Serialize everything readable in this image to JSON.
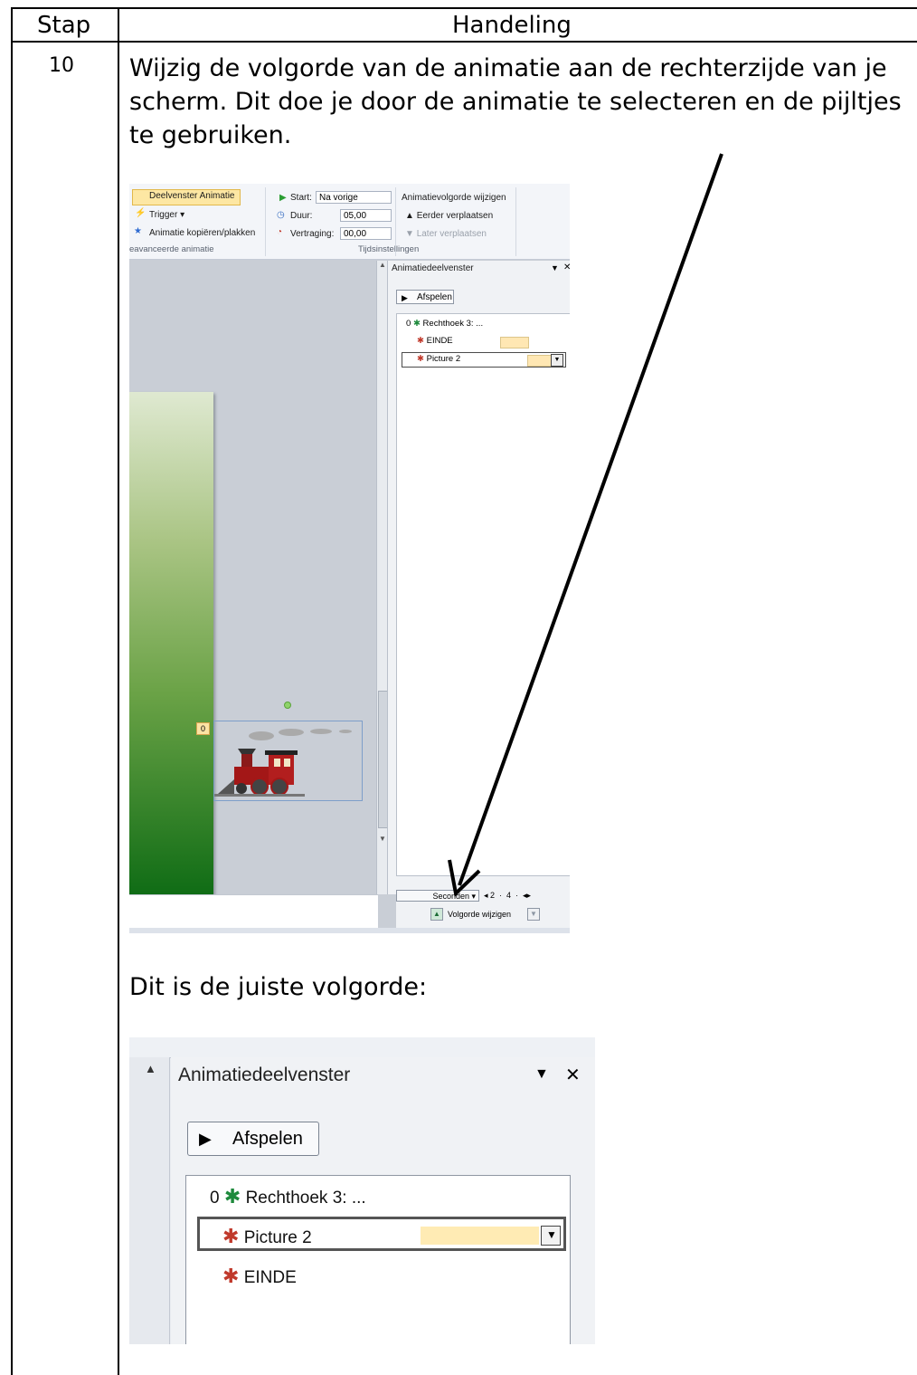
{
  "table": {
    "header_step": "Stap",
    "header_action": "Handeling",
    "step_number": "10",
    "instruction": "Wijzig de volgorde van de animatie aan de rechterzijde van je scherm. Dit doe je door de animatie te selecteren en de pijltjes te gebruiken.",
    "correct_order_label": "Dit is de juiste volgorde:"
  },
  "screenshot1": {
    "ribbon": {
      "pane_button": "Deelvenster Animatie",
      "trigger": "Trigger ▾",
      "copy_paste": "Animatie kopiëren/plakken",
      "group_advanced": "eavanceerde animatie",
      "start_label": "Start:",
      "start_value": "Na vorige",
      "duration_label": "Duur:",
      "duration_value": "05,00",
      "delay_label": "Vertraging:",
      "delay_value": "00,00",
      "group_timing": "Tijdsinstellingen",
      "reorder_header": "Animatievolgorde wijzigen",
      "move_earlier": "Eerder verplaatsen",
      "move_later": "Later verplaatsen"
    },
    "pane": {
      "title": "Animatiedeelvenster",
      "play": "Afspelen",
      "items": [
        {
          "index": "0",
          "label": "Rechthoek 3: ..."
        },
        {
          "index": "",
          "label": "EINDE"
        },
        {
          "index": "",
          "label": "Picture 2"
        }
      ],
      "seconds": "Seconden ▾",
      "timeline": "◂ 2  ·  4  ·  ◂▸",
      "reorder": "Volgorde wijzigen"
    },
    "slide_badge": "0"
  },
  "screenshot2": {
    "title": "Animatiedeelvenster",
    "play": "Afspelen",
    "items": [
      {
        "index": "0",
        "label": "Rechthoek 3: ..."
      },
      {
        "index": "",
        "label": "Picture 2"
      },
      {
        "index": "",
        "label": "EINDE"
      }
    ]
  },
  "colors": {
    "selected_button": "#fde7a3",
    "timing_bar": "#ffe7b3",
    "slide_gradient_top": "#dfe9d1",
    "slide_gradient_bottom": "#0f6c15"
  }
}
